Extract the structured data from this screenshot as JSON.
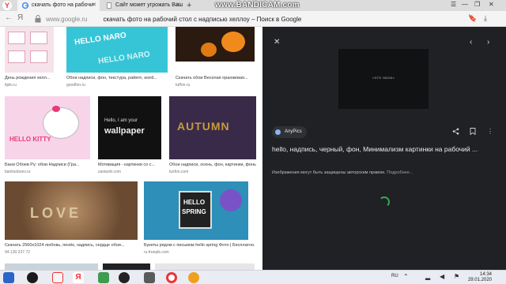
{
  "browser": {
    "tabs": [
      {
        "title": "скачать фото на рабочи",
        "active": true
      },
      {
        "title": "Сайт может угрожать Ваш",
        "active": false
      }
    ],
    "new_tab_symbol": "+",
    "recorder_watermark": "www.BANDICAM.com",
    "url_host": "www.google.ru",
    "url_title": "скачать фото на рабочий стол с надписью хеллоу – Поиск в Google"
  },
  "results": [
    {
      "caption": "День рождения хелл...",
      "source": "tlpik.ru"
    },
    {
      "caption": "Обои надписи, фон, текстура, pattern, word...",
      "source": "goodfon.ru"
    },
    {
      "caption": "Скачать обои Веселая оранжевая...",
      "source": "tuffon.ru"
    },
    {
      "caption": "Бани Обоев Ру: обои Надписи (Гра...",
      "source": "banksoboev.ru"
    },
    {
      "caption": "Мотивация - картинки со с...",
      "source": "zastavki.com"
    },
    {
      "caption": "Обои надписи, осень, фон, картинки, фоны...",
      "source": "tuxfon.com"
    },
    {
      "caption": "Скачать 2560x1024 любовь, пенёк, надпись, сердце обои...",
      "source": "94.130.237.72"
    },
    {
      "caption": "Букеты рядом с письмом hello spring Фото | Бесплатно...",
      "source": "ru.freepik.com"
    }
  ],
  "thumb_text": {
    "hello_naro": "HELLO NARO",
    "hello_kitty": "HELLO KITTY",
    "wallpaper_line1": "Hello, I am your",
    "wallpaper_line2": "wallpaper",
    "autumn": "AUTUMN",
    "love": "LOVE",
    "spring_line1": "HELLO",
    "spring_line2": "SPRING"
  },
  "preview": {
    "image_text": "«ЭТО ОБОИ»",
    "site_name": "AnyPics",
    "title": "hello, надпись, черный, фон, Минимализм картинки на рабочий ...",
    "copyright": "Изображения могут быть защищены авторским правом.",
    "more_link": "Подробнее..."
  },
  "taskbar": {
    "language": "RU",
    "time": "14:34",
    "date": "29.01.2020"
  },
  "colors": {
    "panel_bg": "#202124",
    "spinner": "#34a853",
    "tab_bar": "#dcdcdc"
  }
}
